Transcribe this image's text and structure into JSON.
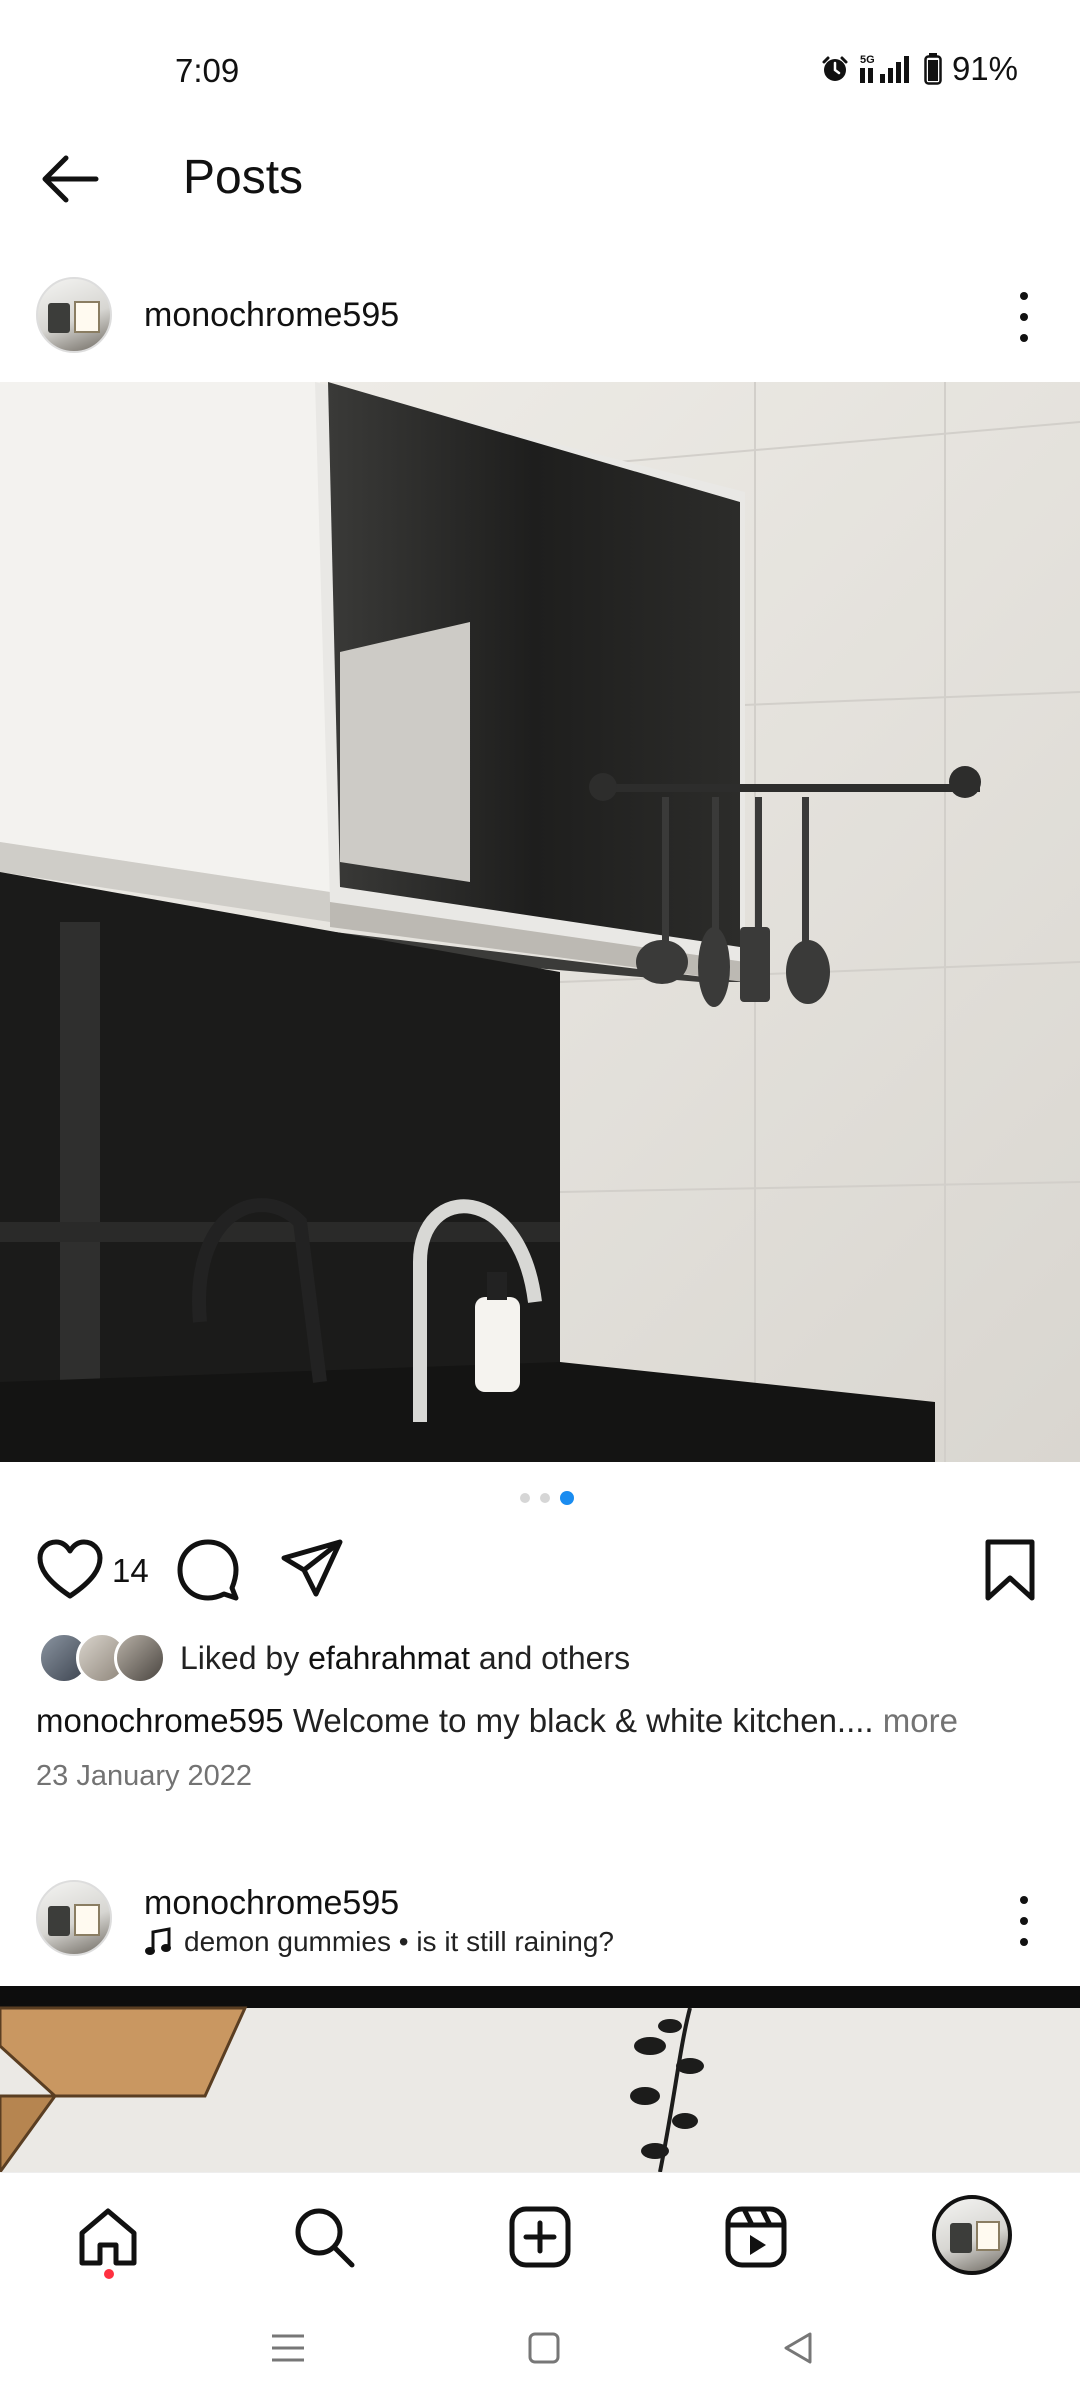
{
  "status_bar": {
    "time": "7:09",
    "network": "5G",
    "battery": "91%"
  },
  "header": {
    "title": "Posts"
  },
  "post1": {
    "username": "monochrome595",
    "image_alt": "black and white kitchen",
    "carousel": {
      "count": 3,
      "active_index": 3
    },
    "like_count": "14",
    "liked_by_prefix": "Liked by",
    "liked_by_user": "efahrahmat",
    "liked_by_suffix": "and others",
    "caption_user": "monochrome595",
    "caption_text": "Welcome to my black & white kitchen....",
    "caption_more": "more",
    "date": "23 January 2022"
  },
  "post2": {
    "username": "monochrome595",
    "audio": "demon gummies • is it still raining?"
  },
  "nav": {
    "items": [
      "home-icon",
      "search-icon",
      "create-icon",
      "reels-icon",
      "profile-avatar"
    ],
    "accent": "#ff3040"
  },
  "colors": {
    "carousel_active": "#1a8cf0",
    "muted_text": "#737373"
  }
}
